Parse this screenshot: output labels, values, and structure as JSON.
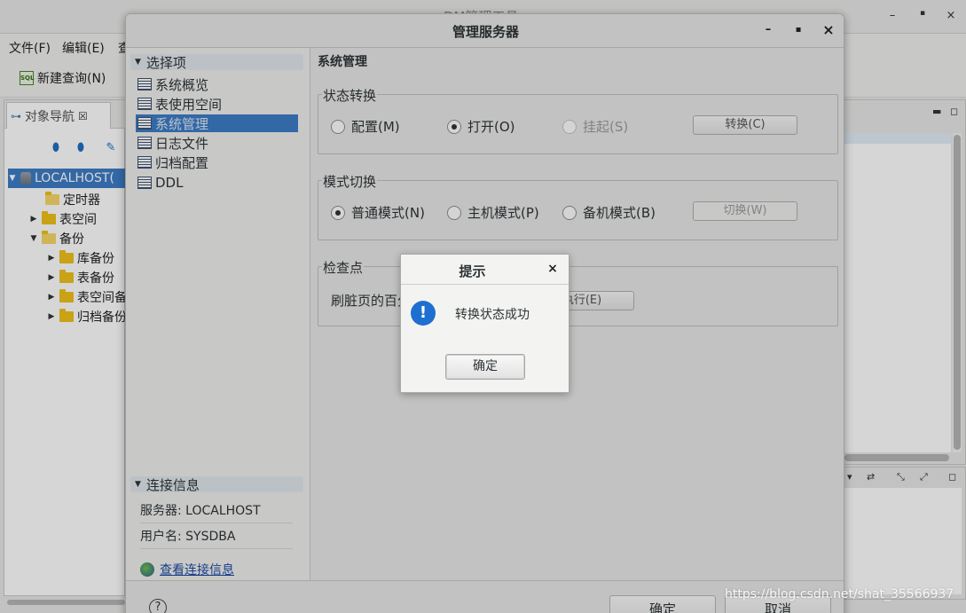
{
  "background": {
    "window_title": "DM管理工具",
    "window_controls": [
      "–",
      "▪",
      "×"
    ],
    "menu": [
      "文件(F)",
      "编辑(E)",
      "查"
    ],
    "toolbar": {
      "new_query": "新建查询(N)"
    },
    "navigator": {
      "tab_label": "对象导航",
      "tree": {
        "root": "LOCALHOST(",
        "items": [
          "定时器",
          "表空间",
          "备份",
          "库备份",
          "表备份",
          "表空间备",
          "归档备份"
        ]
      }
    }
  },
  "dialog": {
    "title": "管理服务器",
    "controls": {
      "minimize": "–",
      "maximize": "▪",
      "close": "×"
    },
    "options_header": "选择项",
    "options": [
      "系统概览",
      "表使用空间",
      "系统管理",
      "日志文件",
      "归档配置",
      "DDL"
    ],
    "selected_option_index": 2,
    "connection_header": "连接信息",
    "server_line": "服务器: LOCALHOST",
    "user_line": "用户名: SYSDBA",
    "view_connection_link": "查看连接信息",
    "main_title": "系统管理",
    "state_group": {
      "label": "状态转换",
      "options": [
        "配置(M)",
        "打开(O)",
        "挂起(S)"
      ],
      "checked": "打开(O)",
      "disabled": [
        "挂起(S)"
      ],
      "button": "转换(C)"
    },
    "mode_group": {
      "label": "模式切换",
      "options": [
        "普通模式(N)",
        "主机模式(P)",
        "备机模式(B)"
      ],
      "checked": "普通模式(N)",
      "button": "切换(W)"
    },
    "checkpoint_group": {
      "label": "检查点",
      "field_label": "刷脏页的百分",
      "button": "执行(E)"
    },
    "help_glyph": "?",
    "ok_button": "确定",
    "cancel_button": "取消"
  },
  "alert": {
    "title": "提示",
    "close_glyph": "×",
    "icon": "info-exclamation-icon",
    "icon_glyph": "!",
    "message": "转换状态成功",
    "ok_button": "确定"
  },
  "watermark": "https://blog.csdn.net/shat_35566937",
  "colors": {
    "selection": "#3d7cc6",
    "info_icon": "#1f6fd0",
    "folder": "#f0c21b",
    "link": "#1c4aa2"
  }
}
